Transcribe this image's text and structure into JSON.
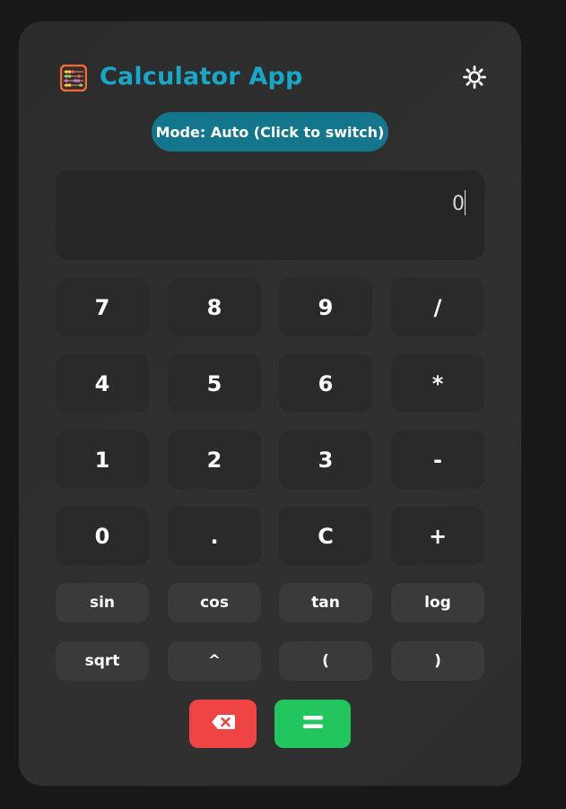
{
  "app": {
    "title": "Calculator App",
    "title_color": "#17a8c9",
    "app_icon": "abacus-icon",
    "theme_icon": "sun-icon"
  },
  "mode": {
    "label": "Mode: Auto (Click to switch)",
    "color": "#14768d"
  },
  "display": {
    "value": "0"
  },
  "keypad": [
    "7",
    "8",
    "9",
    "/",
    "4",
    "5",
    "6",
    "*",
    "1",
    "2",
    "3",
    "-",
    "0",
    ".",
    "C",
    "+"
  ],
  "functions": [
    "sin",
    "cos",
    "tan",
    "log",
    "sqrt",
    "^",
    "(",
    ")"
  ],
  "actions": {
    "backspace_icon": "backspace-icon",
    "backspace_color": "#ef4444",
    "equals_icon": "equals-icon",
    "equals_color": "#22c55e"
  }
}
